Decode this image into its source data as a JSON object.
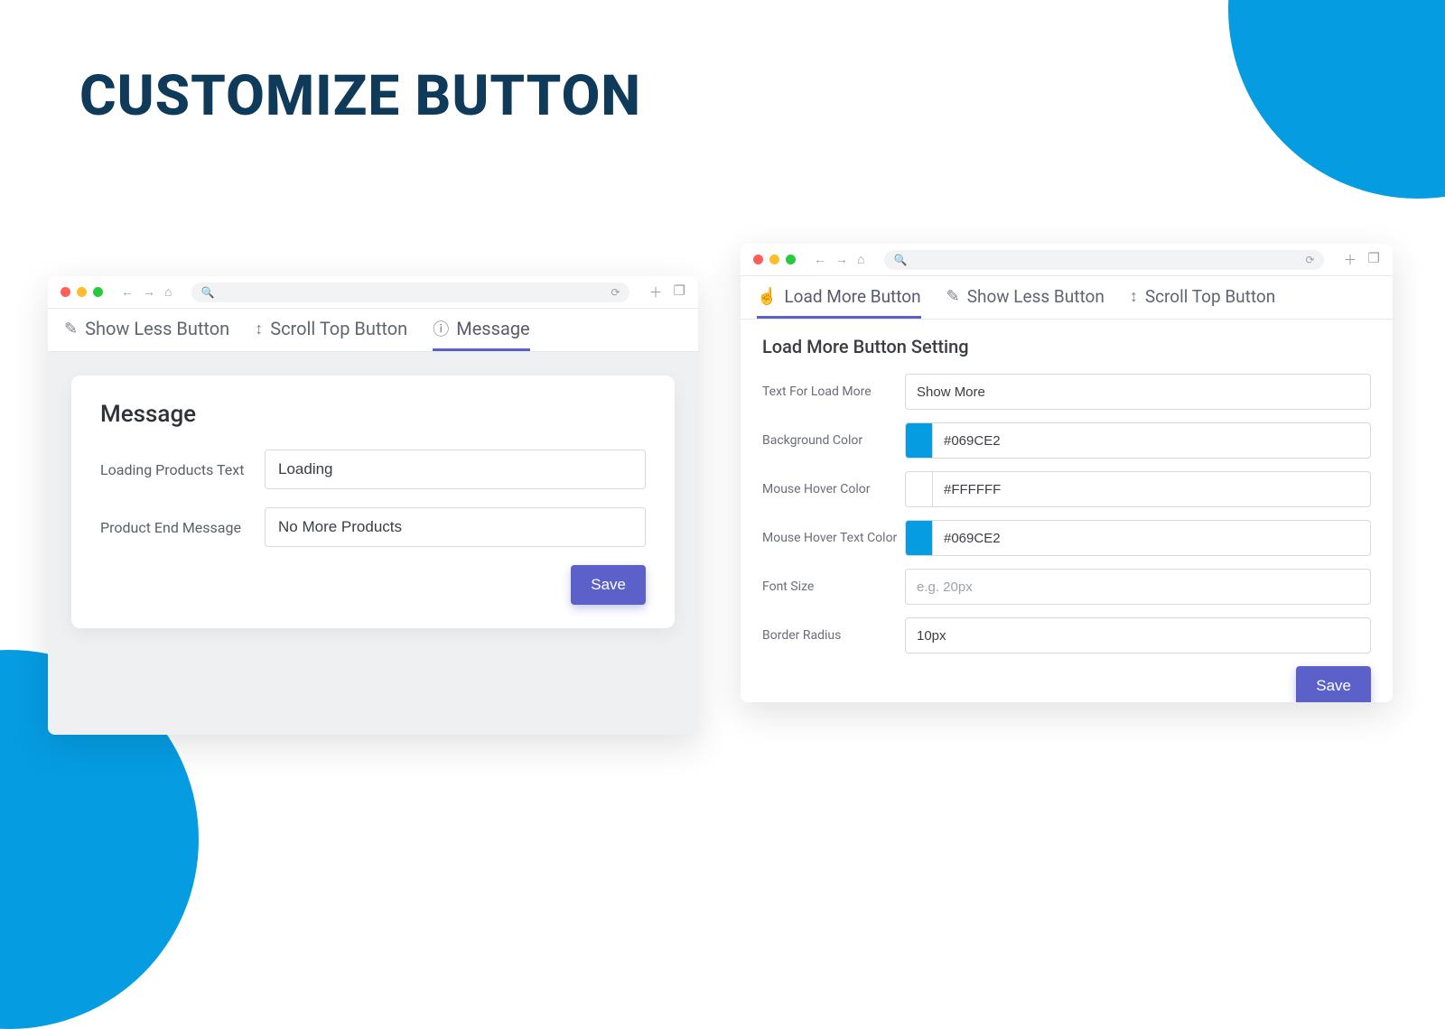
{
  "page": {
    "title": "CUSTOMIZE BUTTON"
  },
  "colors": {
    "accent": "#069CE2",
    "primaryBtn": "#5b61c9",
    "swatchWhite": "#FFFFFF"
  },
  "leftWindow": {
    "tabs": [
      {
        "label": "Show Less Button"
      },
      {
        "label": "Scroll Top Button"
      },
      {
        "label": "Message"
      }
    ],
    "activeTab": 2,
    "card": {
      "title": "Message",
      "fields": {
        "loadingText": {
          "label": "Loading Products Text",
          "value": "Loading"
        },
        "endMessage": {
          "label": "Product End Message",
          "value": "No More Products"
        }
      },
      "saveLabel": "Save"
    }
  },
  "rightWindow": {
    "tabs": [
      {
        "label": "Load More Button"
      },
      {
        "label": "Show Less Button"
      },
      {
        "label": "Scroll Top Button"
      }
    ],
    "activeTab": 0,
    "sectionTitle": "Load More Button Setting",
    "fields": {
      "text": {
        "label": "Text For Load More",
        "value": "Show More"
      },
      "bgColor": {
        "label": "Background Color",
        "value": "#069CE2",
        "swatch": "#069CE2"
      },
      "hoverColor": {
        "label": "Mouse Hover Color",
        "value": "#FFFFFF",
        "swatch": "#FFFFFF"
      },
      "hoverTextColor": {
        "label": "Mouse Hover Text Color",
        "value": "#069CE2",
        "swatch": "#069CE2"
      },
      "fontSize": {
        "label": "Font Size",
        "placeholder": "e.g. 20px",
        "value": ""
      },
      "borderRadius": {
        "label": "Border Radius",
        "value": "10px"
      }
    },
    "saveLabel": "Save"
  }
}
